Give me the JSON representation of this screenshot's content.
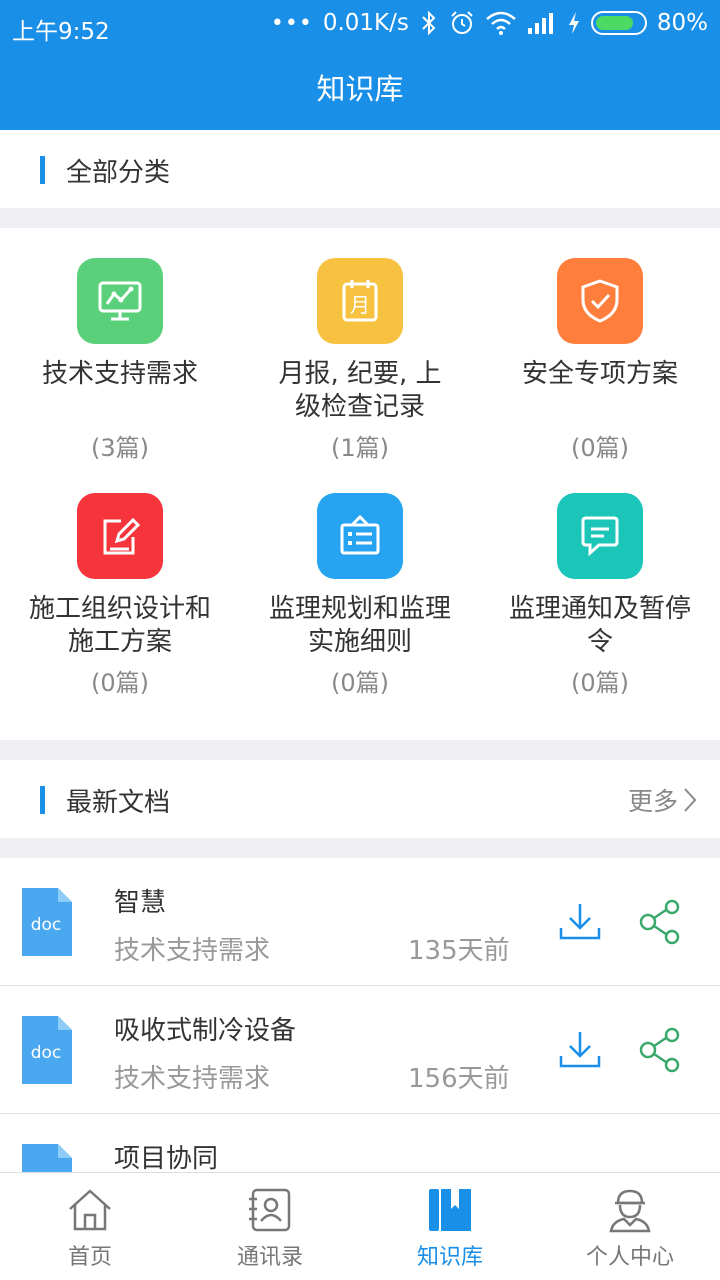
{
  "status_bar": {
    "time": "上午9:52",
    "dots": "•••",
    "speed": "0.01K/s",
    "battery_percent": "80%",
    "battery_level": 0.8,
    "battery_color": "#4cd964"
  },
  "header": {
    "title": "知识库"
  },
  "categories_section": {
    "title": "全部分类"
  },
  "categories": [
    {
      "name": "技术支持需求",
      "count": "(3篇)",
      "icon": "monitor-chart-icon",
      "color": "#5bd07b"
    },
    {
      "name": "月报, 纪要, 上级检查记录",
      "count": "(1篇)",
      "icon": "calendar-month-icon",
      "color": "#f7c23f"
    },
    {
      "name": "安全专项方案",
      "count": "(0篇)",
      "icon": "shield-check-icon",
      "color": "#ff7e3c"
    },
    {
      "name": "施工组织设计和施工方案",
      "count": "(0篇)",
      "icon": "edit-note-icon",
      "color": "#f5343b"
    },
    {
      "name": "监理规划和监理实施细则",
      "count": "(0篇)",
      "icon": "board-list-icon",
      "color": "#26a3f1"
    },
    {
      "name": "监理通知及暂停令",
      "count": "(0篇)",
      "icon": "message-icon",
      "color": "#1bc5b7"
    }
  ],
  "latest_section": {
    "title": "最新文档",
    "more": "更多"
  },
  "documents": [
    {
      "title": "智慧",
      "category": "技术支持需求",
      "time": "135天前",
      "type": "doc"
    },
    {
      "title": "吸收式制冷设备",
      "category": "技术支持需求",
      "time": "156天前",
      "type": "doc"
    },
    {
      "title": "项目协同",
      "category": "",
      "time": "",
      "type": ""
    }
  ],
  "tabs": [
    {
      "label": "首页",
      "icon": "home-icon",
      "active": false
    },
    {
      "label": "通讯录",
      "icon": "contacts-icon",
      "active": false
    },
    {
      "label": "知识库",
      "icon": "bookmark-book-icon",
      "active": true
    },
    {
      "label": "个人中心",
      "icon": "worker-profile-icon",
      "active": false
    }
  ],
  "colors": {
    "accent": "#1a8fe8",
    "share": "#3aa96b",
    "doc_icon": "#4aa8f0"
  }
}
